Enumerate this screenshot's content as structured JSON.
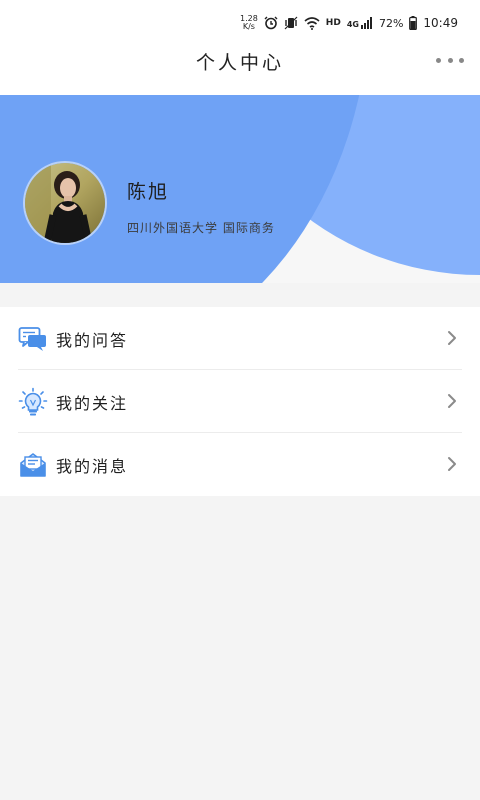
{
  "status_bar": {
    "net_speed_top": "1.28",
    "net_speed_bottom": "K/s",
    "network_label": "HD",
    "signal_label": "4G",
    "battery_percent": "72%",
    "time": "10:49"
  },
  "header": {
    "title": "个人中心"
  },
  "profile": {
    "name": "陈旭",
    "school": "四川外国语大学  国际商务"
  },
  "menu": {
    "items": [
      {
        "label": "我的问答",
        "icon": "chat-bubbles-icon"
      },
      {
        "label": "我的关注",
        "icon": "lightbulb-icon"
      },
      {
        "label": "我的消息",
        "icon": "envelope-icon"
      }
    ]
  },
  "colors": {
    "banner_blue": "#6fa2f5",
    "banner_light": "#85b1fb",
    "icon_blue": "#4a8fe8",
    "background": "#f4f4f4"
  }
}
